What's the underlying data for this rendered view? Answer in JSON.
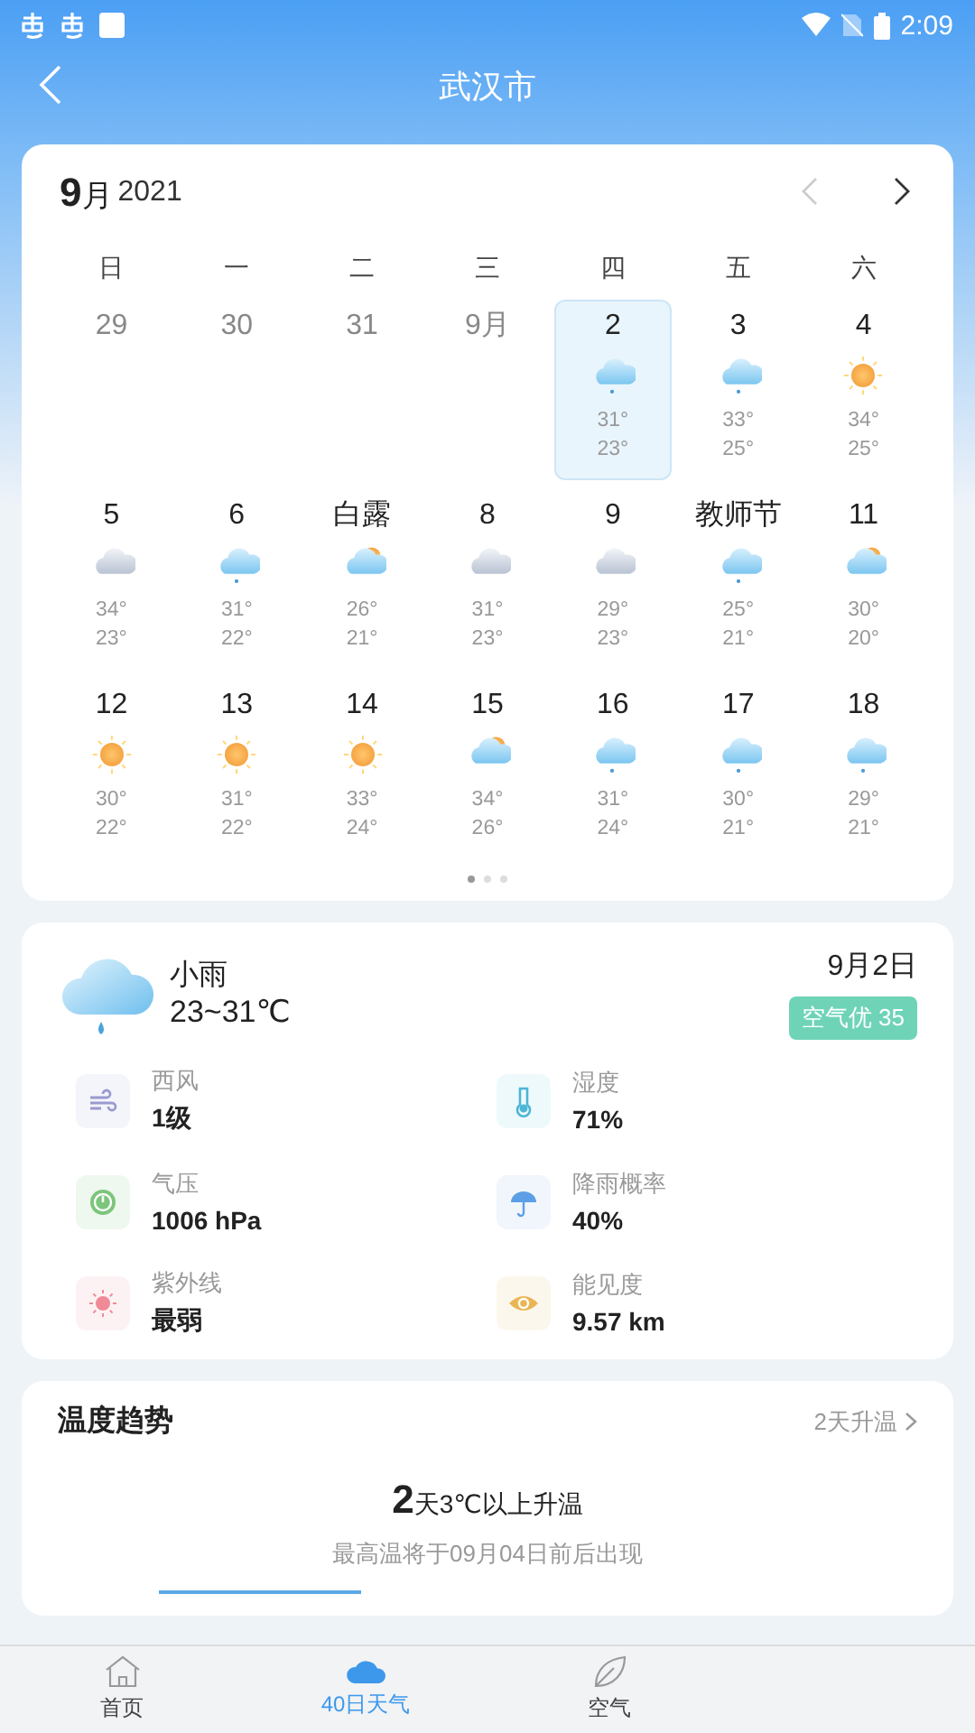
{
  "status_bar": {
    "time": "2:09"
  },
  "header": {
    "title": "武汉市"
  },
  "calendar": {
    "month": "**9**月",
    "year": "2021",
    "weekdays": [
      "日",
      "一",
      "二",
      "三",
      "四",
      "五",
      "六"
    ],
    "weeks": [
      [
        {
          "label": "29",
          "faded": true,
          "selected": false
        },
        {
          "label": "30",
          "faded": true,
          "selected": false
        },
        {
          "label": "31",
          "faded": true,
          "selected": false
        },
        {
          "label": "9月",
          "faded": true,
          "selected": false
        },
        {
          "label": "2",
          "faded": false,
          "selected": true,
          "kind": "rain",
          "high": "31°",
          "low": "23°"
        },
        {
          "label": "3",
          "faded": false,
          "selected": false,
          "kind": "rain",
          "high": "33°",
          "low": "25°"
        },
        {
          "label": "4",
          "faded": false,
          "selected": false,
          "kind": "sun",
          "high": "34°",
          "low": "25°"
        }
      ],
      [
        {
          "label": "5",
          "faded": false,
          "selected": false,
          "kind": "cloud",
          "high": "34°",
          "low": "23°"
        },
        {
          "label": "6",
          "faded": false,
          "selected": false,
          "kind": "rain",
          "high": "31°",
          "low": "22°"
        },
        {
          "label": "白露",
          "faded": false,
          "selected": false,
          "kind": "partly",
          "high": "26°",
          "low": "21°"
        },
        {
          "label": "8",
          "faded": false,
          "selected": false,
          "kind": "cloud",
          "high": "31°",
          "low": "23°"
        },
        {
          "label": "9",
          "faded": false,
          "selected": false,
          "kind": "cloud",
          "high": "29°",
          "low": "23°"
        },
        {
          "label": "教师节",
          "faded": false,
          "selected": false,
          "kind": "rain",
          "high": "25°",
          "low": "21°"
        },
        {
          "label": "11",
          "faded": false,
          "selected": false,
          "kind": "partly",
          "high": "30°",
          "low": "20°"
        }
      ],
      [
        {
          "label": "12",
          "faded": false,
          "selected": false,
          "kind": "sun",
          "high": "30°",
          "low": "22°"
        },
        {
          "label": "13",
          "faded": false,
          "selected": false,
          "kind": "sun",
          "high": "31°",
          "low": "22°"
        },
        {
          "label": "14",
          "faded": false,
          "selected": false,
          "kind": "sun",
          "high": "33°",
          "low": "24°"
        },
        {
          "label": "15",
          "faded": false,
          "selected": false,
          "kind": "partly",
          "high": "34°",
          "low": "26°"
        },
        {
          "label": "16",
          "faded": false,
          "selected": false,
          "kind": "rain",
          "high": "31°",
          "low": "24°"
        },
        {
          "label": "17",
          "faded": false,
          "selected": false,
          "kind": "rain",
          "high": "30°",
          "low": "21°"
        },
        {
          "label": "18",
          "faded": false,
          "selected": false,
          "kind": "rain",
          "high": "29°",
          "low": "21°"
        }
      ]
    ],
    "pages": [
      {
        "selected": true
      },
      {
        "selected": false
      },
      {
        "selected": false
      }
    ]
  },
  "today": {
    "condition": "小雨",
    "range": "23~31℃",
    "date": "9月2日",
    "air_badge": "空气优 35",
    "details": [
      {
        "kind": "wind",
        "label": "西风",
        "value": "1级"
      },
      {
        "kind": "humidity",
        "label": "湿度",
        "value": "71%"
      },
      {
        "kind": "pressure",
        "label": "气压",
        "value": "1006 hPa"
      },
      {
        "kind": "rain",
        "label": "降雨概率",
        "value": "40%"
      },
      {
        "kind": "uv",
        "label": "紫外线",
        "value": "最弱"
      },
      {
        "kind": "visibility",
        "label": "能见度",
        "value": "9.57 km"
      }
    ]
  },
  "trend": {
    "title": "温度趋势",
    "link": "2天升温",
    "headline": "**2**天3℃以上升温",
    "note": "最高温将于09月04日前后出现"
  },
  "tab_bar": [
    {
      "kind": "home",
      "label": "首页",
      "selected": false
    },
    {
      "kind": "cloud",
      "label": "40日天气",
      "selected": true
    },
    {
      "kind": "leaf",
      "label": "空气",
      "selected": false
    }
  ]
}
